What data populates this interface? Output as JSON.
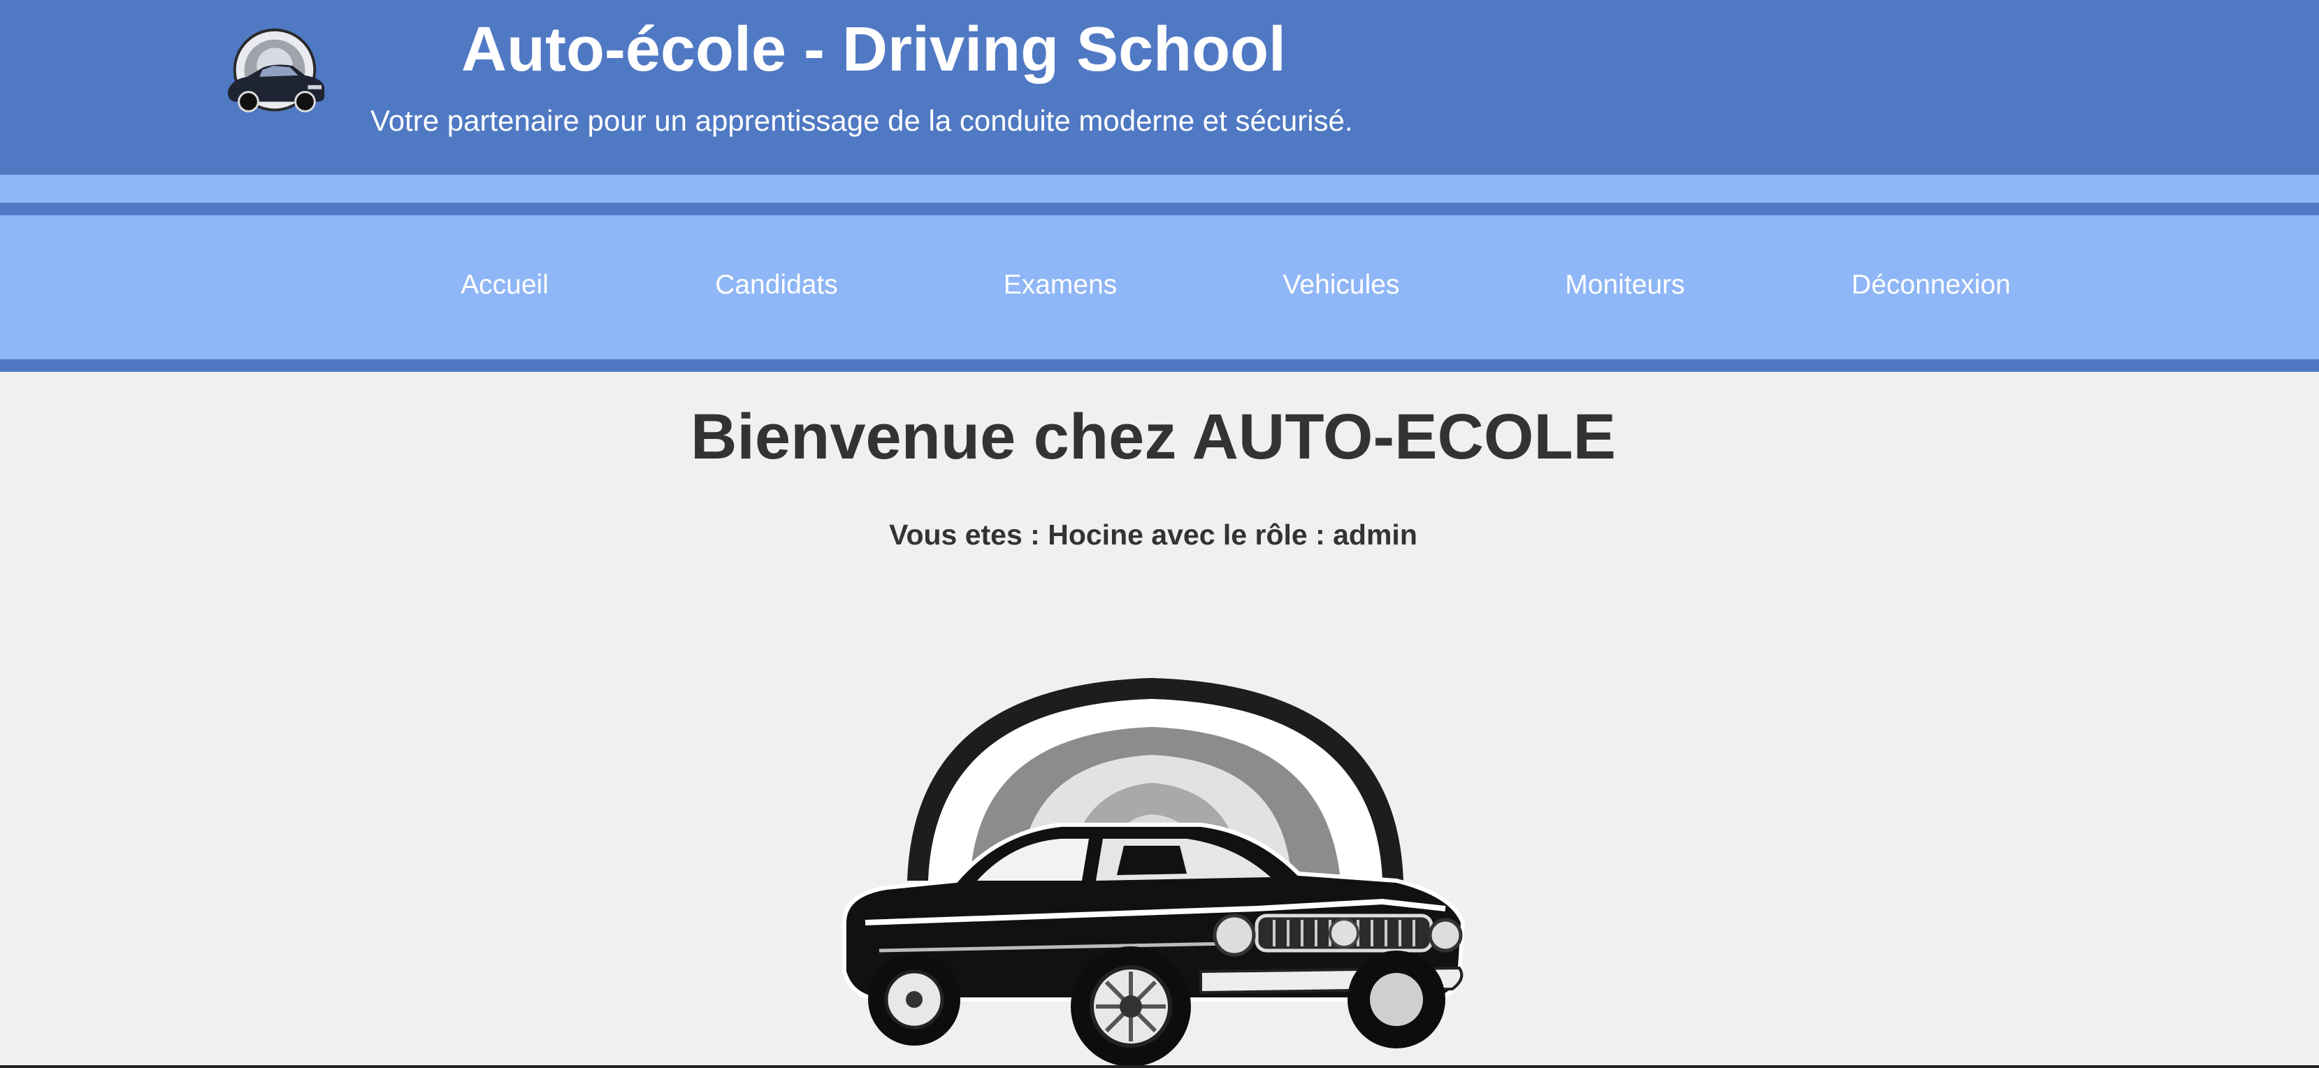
{
  "header": {
    "title": "Auto-école - Driving School",
    "subtitle": "Votre partenaire pour un apprentissage de la conduite moderne et sécurisé.",
    "logo_icon": "car-logo-icon"
  },
  "nav": {
    "items": [
      {
        "label": "Accueil"
      },
      {
        "label": "Candidats"
      },
      {
        "label": "Examens"
      },
      {
        "label": "Vehicules"
      },
      {
        "label": "Moniteurs"
      },
      {
        "label": "Déconnexion"
      }
    ]
  },
  "main": {
    "welcome": "Bienvenue chez AUTO-ECOLE",
    "user_info": "Vous etes : Hocine avec le rôle : admin",
    "hero_icon": "classic-car-illustration"
  },
  "colors": {
    "header_bg": "#5079c4",
    "nav_bg": "#8fb6f6",
    "page_bg": "#f0f0f0",
    "text_dark": "#333333",
    "text_light": "#ffffff"
  }
}
